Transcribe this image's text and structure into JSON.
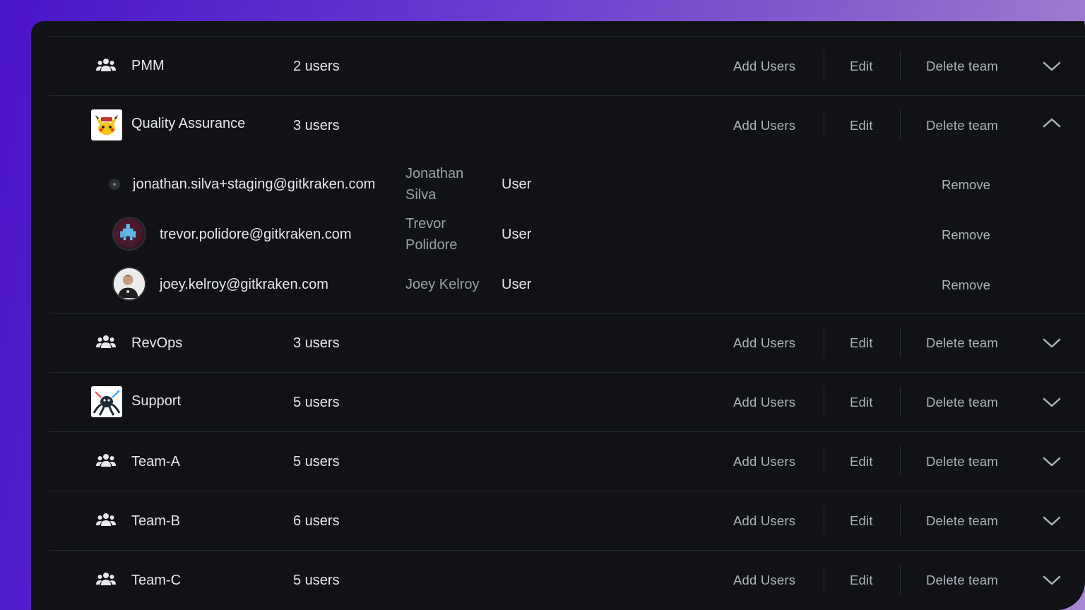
{
  "colors": {
    "panel": "#101216",
    "text": "#e6e8eb",
    "muted": "#9aa0a8",
    "action": "#aeb3bb",
    "divider": "#262930"
  },
  "actions": {
    "add_users": "Add Users",
    "edit": "Edit",
    "delete_team": "Delete team",
    "remove": "Remove"
  },
  "teams": [
    {
      "name": "PMM",
      "count": "2 users",
      "icon": "team-icon",
      "expanded": false
    },
    {
      "name": "Quality Assurance",
      "count": "3 users",
      "icon": "team-avatar-pikachu",
      "expanded": true
    },
    {
      "name": "RevOps",
      "count": "3 users",
      "icon": "team-icon",
      "expanded": false
    },
    {
      "name": "Support",
      "count": "5 users",
      "icon": "team-avatar-kraken",
      "expanded": false
    },
    {
      "name": "Team-A",
      "count": "5 users",
      "icon": "team-icon",
      "expanded": false
    },
    {
      "name": "Team-B",
      "count": "6 users",
      "icon": "team-icon",
      "expanded": false
    },
    {
      "name": "Team-C",
      "count": "5 users",
      "icon": "team-icon",
      "expanded": false
    }
  ],
  "members": [
    {
      "email": "jonathan.silva+staging@gitkraken.com",
      "name_line1": "Jonathan",
      "name_line2": "Silva",
      "role": "User"
    },
    {
      "email": "trevor.polidore@gitkraken.com",
      "name_line1": "Trevor",
      "name_line2": "Polidore",
      "role": "User"
    },
    {
      "email": "joey.kelroy@gitkraken.com",
      "name_line1": "Joey Kelroy",
      "name_line2": "",
      "role": "User"
    }
  ]
}
